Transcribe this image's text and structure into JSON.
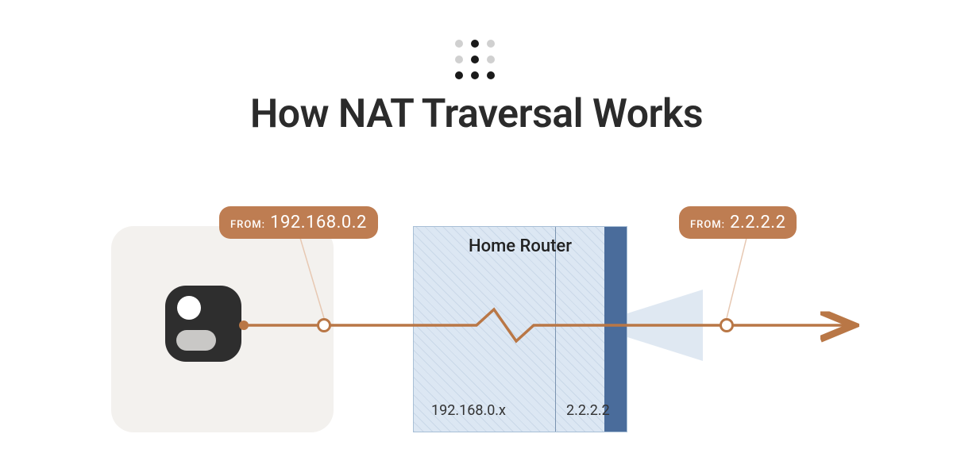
{
  "title": "How NAT Traversal Works",
  "router": {
    "label": "Home Router",
    "lan_subnet": "192.168.0.x",
    "wan_ip": "2.2.2.2"
  },
  "packet_before": {
    "from_label": "FROM:",
    "ip": "192.168.0.2"
  },
  "packet_after": {
    "from_label": "FROM:",
    "ip": "2.2.2.2"
  },
  "colors": {
    "accent": "#b97746",
    "router_bg": "#dce7f3",
    "router_bar": "#4a6c9b"
  },
  "logo_pattern": [
    "light",
    "dark",
    "light",
    "light",
    "dark",
    "light",
    "dark",
    "dark",
    "dark"
  ]
}
